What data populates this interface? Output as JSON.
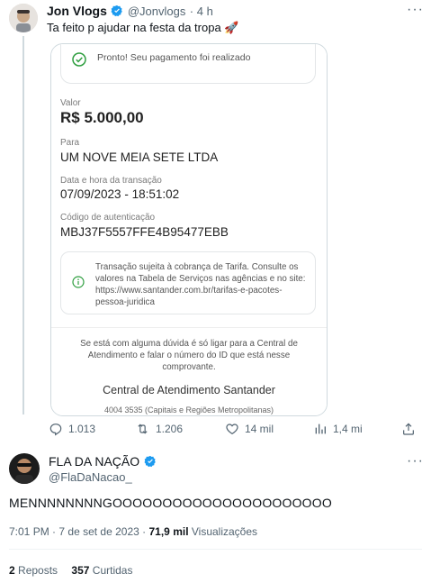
{
  "quoted_tweet": {
    "author_name": "Jon Vlogs",
    "author_handle": "@Jonvlogs",
    "time": "4 h",
    "text": "Ta feito p ajudar na festa da tropa 🚀",
    "screenshot": {
      "success_text": "Pronto! Seu pagamento foi realizado",
      "valor_label": "Valor",
      "valor": "R$ 5.000,00",
      "para_label": "Para",
      "para": "UM NOVE MEIA SETE LTDA",
      "data_label": "Data e hora da transação",
      "data": "07/09/2023 - 18:51:02",
      "codigo_label": "Código de autenticação",
      "codigo": "MBJ37F5557FFE4B95477EBB",
      "note": "Transação sujeita à cobrança de Tarifa. Consulte os valores na Tabela de Serviços nas agências e no site: https://www.santander.com.br/tarifas-e-pacotes-pessoa-juridica",
      "help": "Se está com alguma dúvida é só ligar para a Central de Atendimento e falar o número do ID que está nesse comprovante.",
      "central": "Central de Atendimento Santander",
      "central_phone": "4004 3535 (Capitais e Regiões Metropolitanas)"
    },
    "actions": {
      "replies": "1.013",
      "retweets": "1.206",
      "likes": "14 mil",
      "views": "1,4 mi"
    }
  },
  "main_tweet": {
    "author_name": "FLA DA NAÇÃO",
    "author_handle": "@FlaDaNacao_",
    "text": "MENNNNNNNNGOOOOOOOOOOOOOOOOOOOOOO",
    "time": "7:01 PM",
    "date": "7 de set de 2023",
    "views_count": "71,9 mil",
    "views_label": "Visualizações",
    "reposts_count": "2",
    "reposts_label": "Reposts",
    "likes_count": "357",
    "likes_label": "Curtidas"
  },
  "colors": {
    "verified": "#1d9bf0",
    "secondary_text": "#536471",
    "success": "#2e9e3f"
  }
}
